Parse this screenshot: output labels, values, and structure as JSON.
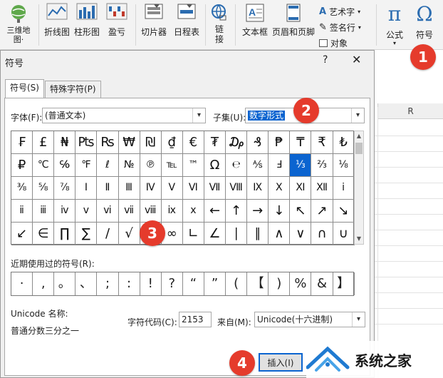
{
  "ribbon": {
    "items": [
      {
        "label": "三维地\n图·"
      },
      {
        "label": "折线图"
      },
      {
        "label": "柱形图"
      },
      {
        "label": "盈亏"
      },
      {
        "label": "切片器"
      },
      {
        "label": "日程表"
      },
      {
        "label": "链\n接"
      },
      {
        "label": "文本框"
      },
      {
        "label": "页眉和页脚"
      }
    ],
    "wordart": "艺术字",
    "signature": "签名行",
    "object": "对象",
    "equation": "公式",
    "symbol": "符号",
    "group_label": "符"
  },
  "dialog": {
    "title": "符号",
    "help": "?",
    "close": "✕",
    "tabs": [
      "符号(S)",
      "特殊字符(P)"
    ],
    "font_label": "字体(F):",
    "font_value": "(普通文本)",
    "subset_label": "子集(U):",
    "subset_value": "数字形式",
    "symbols": [
      [
        "₣",
        "£",
        "₦",
        "₧",
        "₨",
        "₩",
        "₪",
        "₫",
        "€",
        "₮",
        "₯",
        "₰",
        "₱",
        "₸",
        "₹",
        "₺"
      ],
      [
        "₽",
        "℃",
        "℅",
        "℉",
        "ℓ",
        "№",
        "℗",
        "℡",
        "™",
        "Ω",
        "℮",
        "⅍",
        "Ⅎ",
        "⅓",
        "⅔",
        "⅛"
      ],
      [
        "⅜",
        "⅝",
        "⅞",
        "Ⅰ",
        "Ⅱ",
        "Ⅲ",
        "Ⅳ",
        "Ⅴ",
        "Ⅵ",
        "Ⅶ",
        "Ⅷ",
        "Ⅸ",
        "Ⅹ",
        "Ⅺ",
        "Ⅻ",
        "ⅰ"
      ],
      [
        "ⅱ",
        "ⅲ",
        "ⅳ",
        "ⅴ",
        "ⅵ",
        "ⅶ",
        "ⅷ",
        "ⅸ",
        "ⅹ",
        "←",
        "↑",
        "→",
        "↓",
        "↖",
        "↗",
        "↘"
      ],
      [
        "↙",
        "∈",
        "∏",
        "∑",
        "∕",
        "√",
        "∝",
        "∞",
        "∟",
        "∠",
        "∣",
        "∥",
        "∧",
        "∨",
        "∩",
        "∪"
      ]
    ],
    "selected_symbol": "⅓",
    "recent_label": "近期使用过的符号(R):",
    "recent_symbols": [
      "·",
      ",",
      "。",
      "、",
      ";",
      ":",
      "!",
      "?",
      "“",
      "”",
      "(",
      "【",
      ")",
      "%",
      "&",
      "】"
    ],
    "unicode_name_label": "Unicode 名称:",
    "unicode_name_value": "普通分数三分之一",
    "char_code_label": "字符代码(C):",
    "char_code_value": "2153",
    "from_label": "来自(M):",
    "from_value": "Unicode(十六进制)",
    "insert_button": "插入(I)"
  },
  "sheet": {
    "column_label": "R"
  },
  "badges": [
    "1",
    "2",
    "3",
    "4"
  ],
  "watermark": {
    "text": "系统之家"
  },
  "colors": {
    "accent": "#0b64d0",
    "badge": "#e53b2c"
  }
}
